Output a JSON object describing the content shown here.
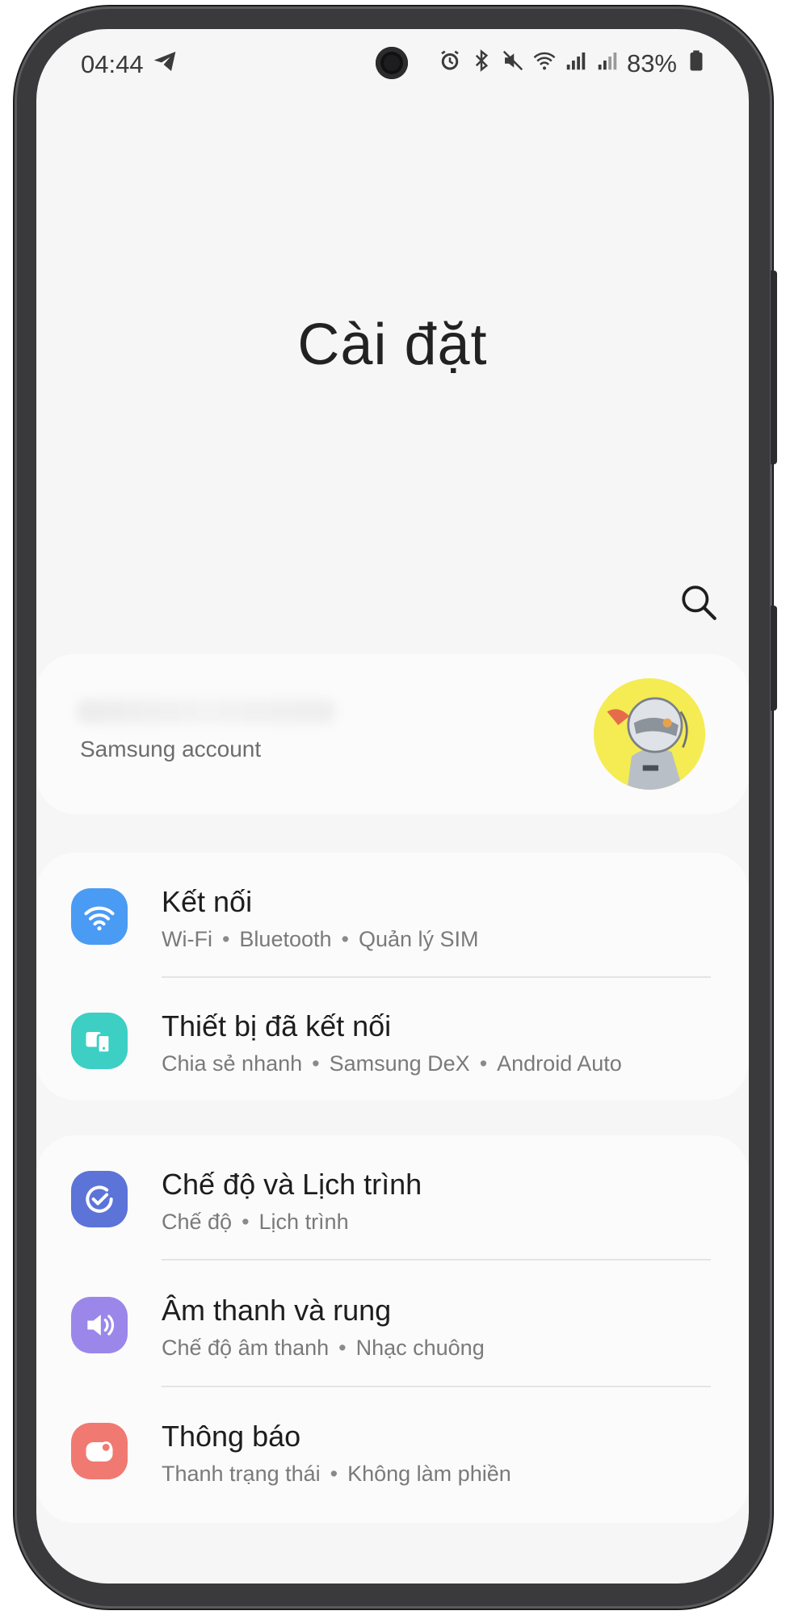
{
  "status_bar": {
    "time": "04:44",
    "battery": "83%",
    "icons": [
      "telegram-icon",
      "alarm-icon",
      "bluetooth-icon",
      "mute-icon",
      "wifi-icon",
      "signal-icon",
      "signal-icon",
      "battery-icon"
    ]
  },
  "header": {
    "title": "Cài đặt",
    "search_icon": "search-icon"
  },
  "account": {
    "label": "Samsung account"
  },
  "groups": [
    {
      "items": [
        {
          "title": "Kết nối",
          "icon": "wifi-icon",
          "color": "#4a9bf3",
          "sub": [
            "Wi-Fi",
            "Bluetooth",
            "Quản lý SIM"
          ]
        },
        {
          "title": "Thiết bị đã kết nối",
          "icon": "connected-devices-icon",
          "color": "#3dcfc4",
          "sub": [
            "Chia sẻ nhanh",
            "Samsung DeX",
            "Android Auto"
          ]
        }
      ]
    },
    {
      "items": [
        {
          "title": "Chế độ và Lịch trình",
          "icon": "modes-check-icon",
          "color": "#5c73d8",
          "sub": [
            "Chế độ",
            "Lịch trình"
          ]
        },
        {
          "title": "Âm thanh và rung",
          "icon": "speaker-icon",
          "color": "#9b87ea",
          "sub": [
            "Chế độ âm thanh",
            "Nhạc chuông"
          ]
        },
        {
          "title": "Thông báo",
          "icon": "notification-icon",
          "color": "#f07a72",
          "sub": [
            "Thanh trạng thái",
            "Không làm phiền"
          ]
        }
      ]
    }
  ]
}
